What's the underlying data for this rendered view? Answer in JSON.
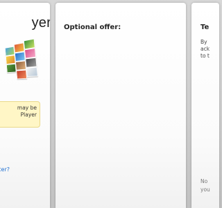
{
  "left": {
    "title_fragment": "yer",
    "notice_line1": "may be",
    "notice_line2": "Player",
    "link_fragment": "ter?",
    "link_color": "#1f6fd1",
    "notice_bg": "#fff6c6"
  },
  "middle": {
    "heading": "Optional offer:"
  },
  "right": {
    "heading_fragment": "Te",
    "text_line1": "By",
    "text_line2": "ack",
    "text_line3": "to t",
    "bottom_line1": "No",
    "bottom_line2": "you"
  }
}
